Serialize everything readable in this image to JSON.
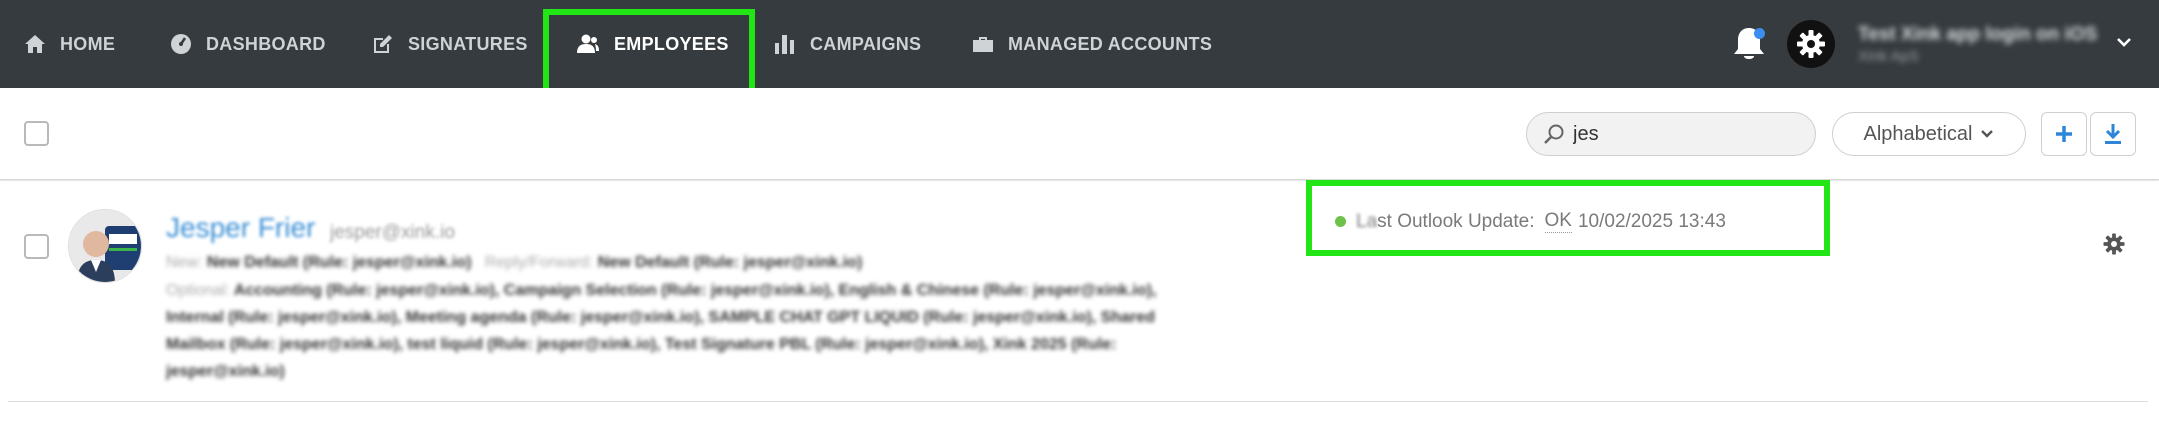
{
  "nav": {
    "items": [
      {
        "label": "HOME",
        "icon": "home-icon"
      },
      {
        "label": "DASHBOARD",
        "icon": "dashboard-icon"
      },
      {
        "label": "SIGNATURES",
        "icon": "edit-icon"
      },
      {
        "label": "EMPLOYEES",
        "icon": "users-icon",
        "active": true
      },
      {
        "label": "CAMPAIGNS",
        "icon": "bar-chart-icon"
      },
      {
        "label": "MANAGED ACCOUNTS",
        "icon": "briefcase-icon"
      }
    ],
    "user": {
      "name": "Test Xink app login on iOS",
      "company": "Xink ApS"
    }
  },
  "toolbar": {
    "search_value": "jes",
    "sort_label": "Alphabetical"
  },
  "employee": {
    "name": "Jesper Frier",
    "email": "jesper@xink.io",
    "new_label": "New:",
    "new_value": "New Default (Rule: jesper@xink.io)",
    "reply_label": "Reply/Forward:",
    "reply_value": "New Default (Rule: jesper@xink.io)",
    "optional_label": "Optional:",
    "optional_lines": [
      "Accounting (Rule: jesper@xink.io), Campaign Selection (Rule: jesper@xink.io), English & Chinese (Rule: jesper@xink.io),",
      "Internal (Rule: jesper@xink.io), Meeting agenda (Rule: jesper@xink.io), SAMPLE CHAT GPT LIQUID (Rule: jesper@xink.io), Shared",
      "Mailbox (Rule: jesper@xink.io), test liquid (Rule: jesper@xink.io), Test Signature PBL (Rule: jesper@xink.io), Xink 2025 (Rule:",
      "jesper@xink.io)"
    ],
    "status_prefix": "La",
    "status_label": "st Outlook Update:",
    "status_ok": "OK",
    "status_time": "10/02/2025 13:43"
  },
  "colors": {
    "navbar": "#353b3e",
    "highlight": "#22e515",
    "accent": "#3a8fd6",
    "ok_dot": "#6cc24a"
  }
}
